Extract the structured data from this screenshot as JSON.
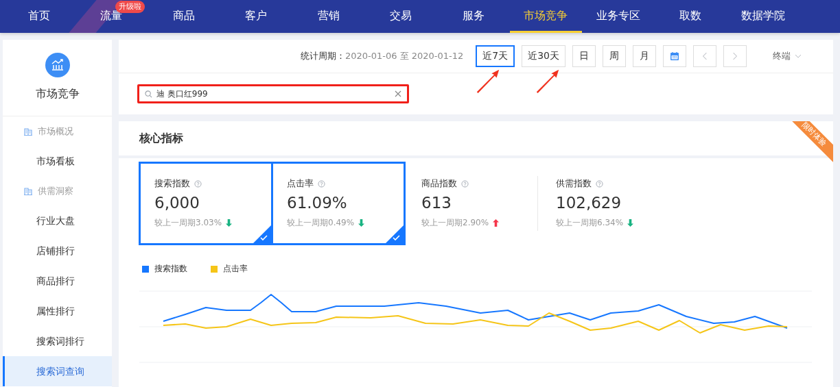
{
  "nav": [
    {
      "label": "首页",
      "selected": false
    },
    {
      "label": "流量",
      "selected": false,
      "badge": "升级啦"
    },
    {
      "label": "商品",
      "selected": false
    },
    {
      "label": "客户",
      "selected": false
    },
    {
      "label": "营销",
      "selected": false
    },
    {
      "label": "交易",
      "selected": false
    },
    {
      "label": "服务",
      "selected": false
    },
    {
      "label": "市场竞争",
      "selected": true
    },
    {
      "label": "业务专区",
      "selected": false
    },
    {
      "label": "取数",
      "selected": false
    },
    {
      "label": "数据学院",
      "selected": false
    }
  ],
  "sidebar": {
    "title": "市场竞争",
    "items": [
      {
        "kind": "group",
        "label": "市场概况"
      },
      {
        "kind": "item",
        "label": "市场看板",
        "selected": false
      },
      {
        "kind": "group",
        "label": "供需洞察"
      },
      {
        "kind": "item",
        "label": "行业大盘",
        "selected": false
      },
      {
        "kind": "item",
        "label": "店铺排行",
        "selected": false
      },
      {
        "kind": "item",
        "label": "商品排行",
        "selected": false
      },
      {
        "kind": "item",
        "label": "属性排行",
        "selected": false
      },
      {
        "kind": "item",
        "label": "搜索词排行",
        "selected": false
      },
      {
        "kind": "item",
        "label": "搜索词查询",
        "selected": true
      }
    ]
  },
  "period": {
    "label": "统计周期：",
    "value": "2020-01-06 至 2020-01-12",
    "buttons": [
      {
        "label": "近7天",
        "selected": true
      },
      {
        "label": "近30天",
        "selected": false
      },
      {
        "label": "日",
        "selected": false
      },
      {
        "label": "周",
        "selected": false
      },
      {
        "label": "月",
        "selected": false
      }
    ],
    "terminal": "终端"
  },
  "search": {
    "value": "迪 奥口红999",
    "highlighted": true
  },
  "core": {
    "title": "核心指标",
    "ribbon": "限时体验",
    "metrics": [
      {
        "name": "搜索指数",
        "value": "6,000",
        "compare": "较上一周期3.03%",
        "kind": "down",
        "selected": true
      },
      {
        "name": "点击率",
        "value": "61.09%",
        "compare": "较上一周期0.49%",
        "kind": "down",
        "selected": true
      },
      {
        "name": "商品指数",
        "value": "613",
        "compare": "较上一周期2.90%",
        "kind": "up",
        "selected": false
      },
      {
        "name": "供需指数",
        "value": "102,629",
        "compare": "较上一周期6.34%",
        "kind": "down",
        "selected": false
      }
    ],
    "legend": [
      {
        "label": "搜索指数",
        "color": "#1677ff"
      },
      {
        "label": "点击率",
        "color": "#f5c518"
      }
    ]
  }
}
